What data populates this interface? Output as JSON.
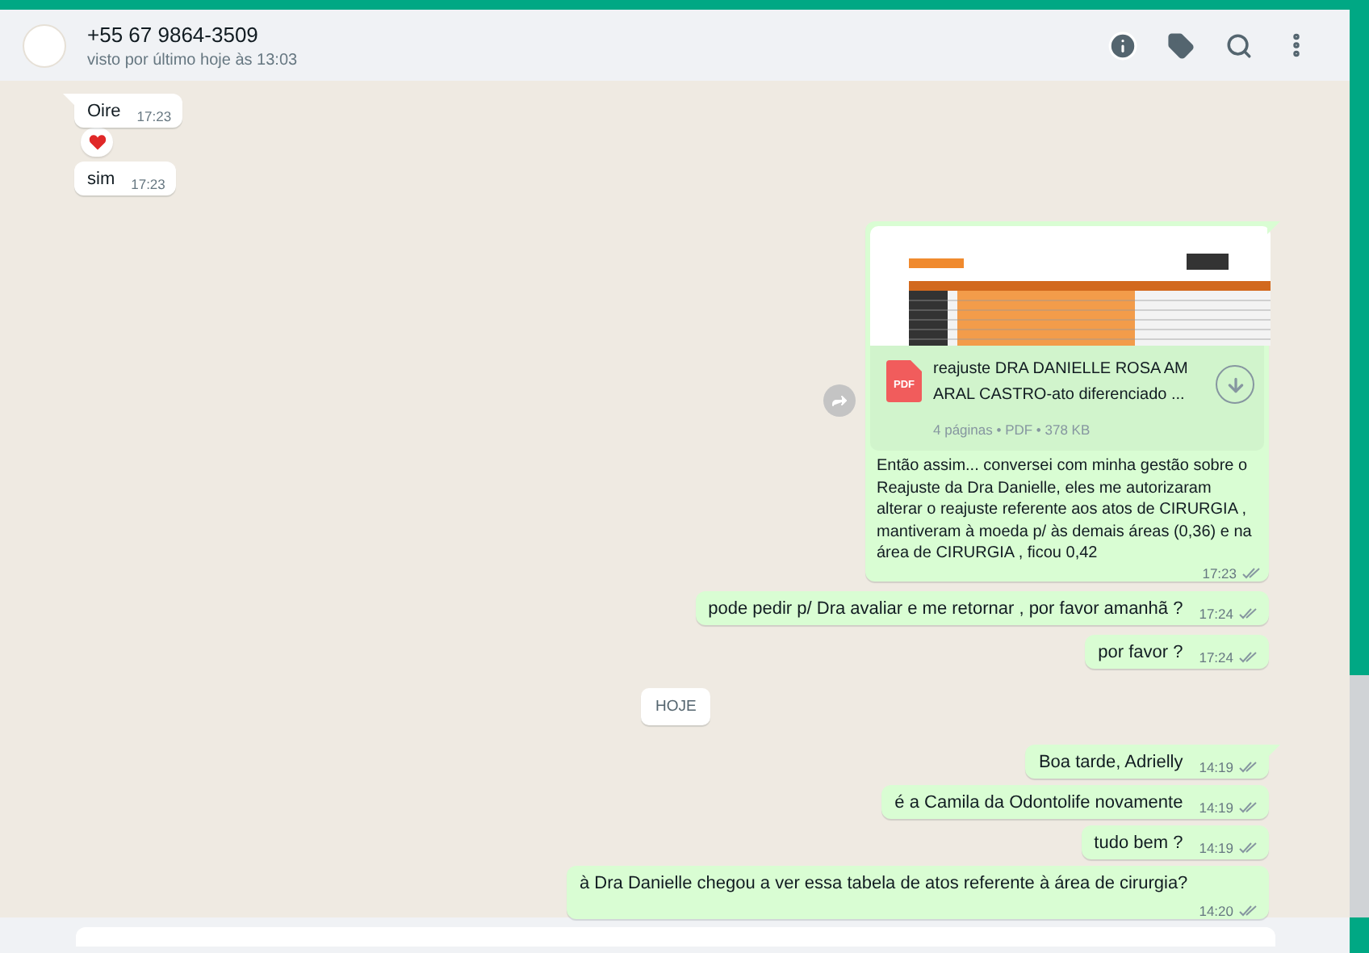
{
  "header": {
    "name": "+55 67 9864-3509",
    "status": "visto por último hoje às 13:03"
  },
  "messages": [
    {
      "kind": "text",
      "outgoing": false,
      "tail": true,
      "text": "Oire",
      "time": "17:23"
    },
    {
      "kind": "reaction",
      "outgoing": false
    },
    {
      "kind": "text",
      "outgoing": false,
      "tail": false,
      "text": "sim",
      "time": "17:23"
    },
    {
      "kind": "document",
      "outgoing": true,
      "tail": true,
      "file_name": "reajuste DRA DANIELLE ROSA AM\nARAL CASTRO-ato diferenciado ...",
      "file_info": "4 páginas • PDF • 378 KB",
      "file_type": "PDF",
      "text": "Então assim... conversei com minha gestão sobre o Reajuste da Dra Danielle, eles me autorizaram alterar o reajuste referente aos atos de CIRURGIA , mantiveram à moeda p/ às demais áreas (0,36) e na área de CIRURGIA , ficou 0,42",
      "time": "17:23",
      "read": false
    },
    {
      "kind": "text",
      "outgoing": true,
      "tail": false,
      "text": "pode pedir p/ Dra avaliar e me retornar , por favor amanhã ?",
      "time": "17:24",
      "read": false
    },
    {
      "kind": "text",
      "outgoing": true,
      "tail": false,
      "text": "por favor ?",
      "time": "17:24",
      "read": false
    },
    {
      "kind": "date",
      "text": "HOJE"
    },
    {
      "kind": "text",
      "outgoing": true,
      "tail": true,
      "text": "Boa tarde, Adrielly",
      "time": "14:19",
      "read": false
    },
    {
      "kind": "text",
      "outgoing": true,
      "tail": false,
      "text": "é a Camila da Odontolife novamente",
      "time": "14:19",
      "read": false
    },
    {
      "kind": "text",
      "outgoing": true,
      "tail": false,
      "text": "tudo bem ?",
      "time": "14:19",
      "read": false
    },
    {
      "kind": "text",
      "outgoing": true,
      "tail": false,
      "text": "à Dra Danielle chegou a ver essa tabela de atos referente à área de cirurgia?",
      "time": "14:20",
      "read": false
    }
  ]
}
